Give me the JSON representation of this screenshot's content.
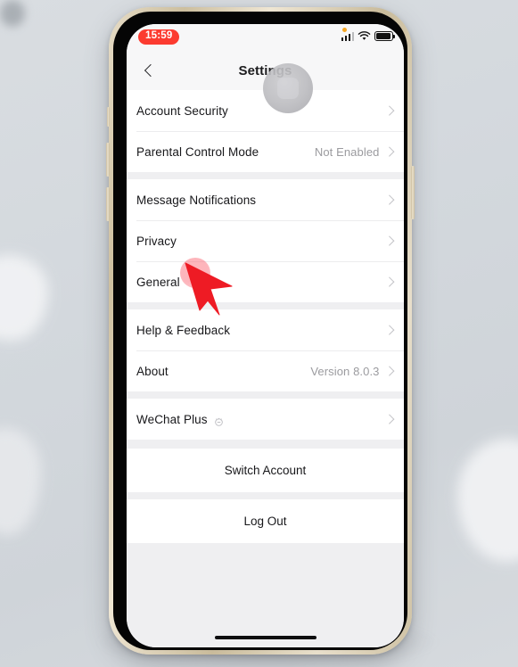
{
  "status_bar": {
    "time": "15:59",
    "recording_indicator": "orange-dot",
    "signal_icon": "cellular-signal-icon",
    "wifi_icon": "wifi-icon",
    "battery_icon": "battery-icon"
  },
  "nav": {
    "back_icon": "chevron-left-icon",
    "title": "Settings"
  },
  "overlay": {
    "assistive_touch": "assistive-touch-button",
    "tap_indicator": "tap-highlight",
    "cursor": "pointer-arrow",
    "accent_red": "#ee1b24",
    "tap_pink": "#fb5a69"
  },
  "groups": [
    {
      "rows": [
        {
          "label": "Account Security",
          "value": "",
          "chevron": true
        },
        {
          "label": "Parental Control Mode",
          "value": "Not Enabled",
          "chevron": true
        }
      ]
    },
    {
      "rows": [
        {
          "label": "Message Notifications",
          "value": "",
          "chevron": true
        },
        {
          "label": "Privacy",
          "value": "",
          "chevron": true
        },
        {
          "label": "General",
          "value": "",
          "chevron": true
        }
      ]
    },
    {
      "rows": [
        {
          "label": "Help & Feedback",
          "value": "",
          "chevron": true
        },
        {
          "label": "About",
          "value": "Version 8.0.3",
          "chevron": true
        }
      ]
    },
    {
      "rows": [
        {
          "label": "WeChat Plus",
          "value": "",
          "chevron": true,
          "badge": "plus-badge-icon"
        }
      ]
    }
  ],
  "actions": [
    {
      "label": "Switch Account"
    },
    {
      "label": "Log Out"
    }
  ],
  "home_indicator": "home-indicator"
}
